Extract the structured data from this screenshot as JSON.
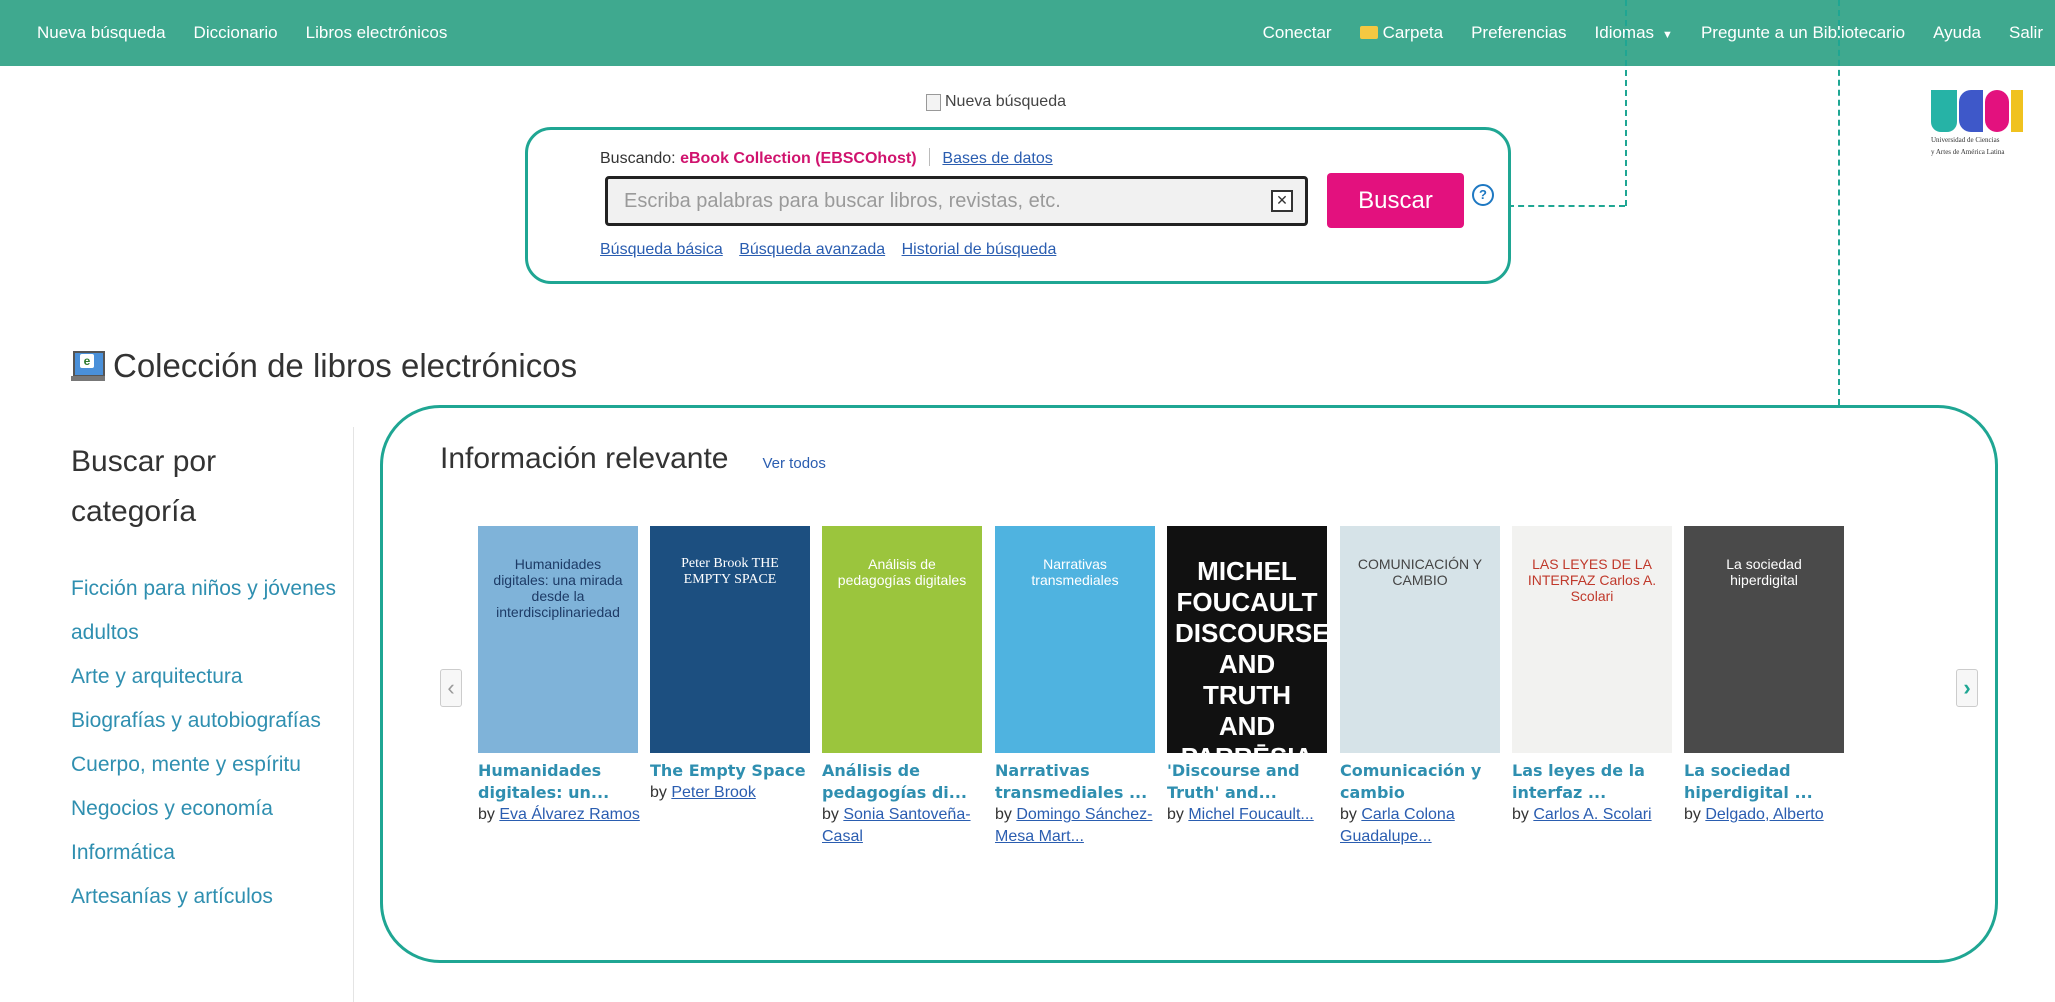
{
  "topbar": {
    "left_links": [
      "Nueva búsqueda",
      "Diccionario",
      "Libros electrónicos"
    ],
    "connect": "Conectar",
    "folder": "Carpeta",
    "preferences": "Preferencias",
    "languages": "Idiomas",
    "ask_librarian": "Pregunte a un Bibliotecario",
    "help": "Ayuda",
    "exit": "Salir"
  },
  "banner": {
    "alt": "Nueva búsqueda"
  },
  "search": {
    "searching_label": "Buscando:",
    "collection": "eBook Collection (EBSCOhost)",
    "databases_link": "Bases de datos",
    "placeholder": "Escriba palabras para buscar libros, revistas, etc.",
    "value": "",
    "button": "Buscar",
    "help": "?",
    "basic_search": "Búsqueda básica",
    "advanced_search": "Búsqueda avanzada",
    "search_history": "Historial de búsqueda"
  },
  "logo": {
    "line1": "Universidad de Ciencias",
    "line2": "y Artes de América Latina"
  },
  "page": {
    "title": "Colección de libros electrónicos"
  },
  "sidebar": {
    "heading": "Buscar por categoría",
    "categories": [
      "Ficción para niños y jóvenes adultos",
      "Arte y arquitectura",
      "Biografías y autobiografías",
      "Cuerpo, mente y espíritu",
      "Negocios y economía",
      "Informática",
      "Artesanías y artículos"
    ]
  },
  "relevant": {
    "title": "Información relevante",
    "view_all": "Ver todos",
    "books": [
      {
        "title": "Humanidades digitales: un...",
        "by": "by",
        "author": "Eva Álvarez Ramos",
        "cover_bg": "#7fb3d9",
        "cover_text": "Humanidades digitales: una mirada desde la interdisciplinariedad"
      },
      {
        "title": "The Empty Space",
        "by": "by",
        "author": "Peter Brook",
        "cover_bg": "#1c4f80",
        "cover_text": "Peter Brook THE EMPTY SPACE"
      },
      {
        "title": "Análisis de pedagogías di...",
        "by": "by",
        "author": "Sonia Santoveña-Casal",
        "cover_bg": "#9bc53d",
        "cover_text": "Análisis de pedagogías digitales"
      },
      {
        "title": "Narrativas transmediales ...",
        "by": "by",
        "author": "Domingo Sánchez-Mesa Mart...",
        "cover_bg": "#4fb3e0",
        "cover_text": "Narrativas transmediales"
      },
      {
        "title": "'Discourse and Truth' and...",
        "by": "by",
        "author": "Michel Foucault...",
        "cover_bg": "#111111",
        "cover_text": "MICHEL FOUCAULT DISCOURSE AND TRUTH AND PARRĒSIA"
      },
      {
        "title": "Comunicación y cambio",
        "by": "by",
        "author": "Carla Colona Guadalupe...",
        "cover_bg": "#d6e3e8",
        "cover_text": "COMUNICACIÓN Y CAMBIO"
      },
      {
        "title": "Las leyes de la interfaz ...",
        "by": "by",
        "author": "Carlos A. Scolari",
        "cover_bg": "#f2f2f0",
        "cover_text": "LAS LEYES DE LA INTERFAZ Carlos A. Scolari"
      },
      {
        "title": "La sociedad hiperdigital ...",
        "by": "by",
        "author": "Delgado, Alberto",
        "cover_bg": "#4a4a4a",
        "cover_text": "La sociedad hiperdigital"
      }
    ]
  }
}
